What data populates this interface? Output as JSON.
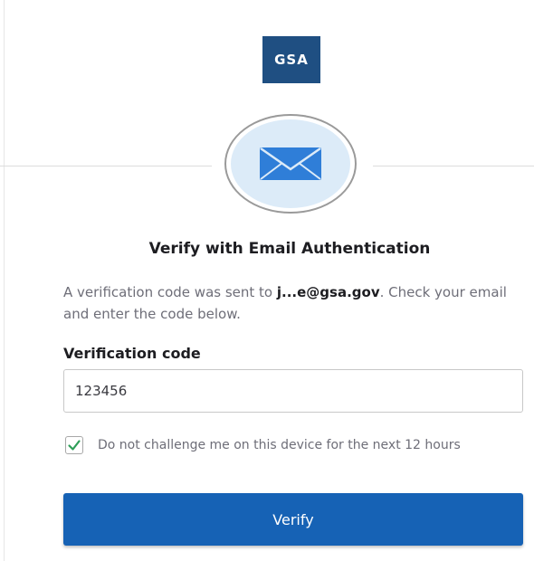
{
  "logo": {
    "text": "GSA"
  },
  "page": {
    "title": "Verify with Email Authentication",
    "description_prefix": "A verification code was sent to ",
    "masked_email": "j...e@gsa.gov",
    "description_suffix": ". Check your email and enter the code below."
  },
  "form": {
    "code_label": "Verification code",
    "code_value": "123456",
    "remember_checked": true,
    "remember_label": "Do not challenge me on this device for the next 12 hours",
    "submit_label": "Verify"
  },
  "colors": {
    "brand": "#1f4f82",
    "button": "#1662b5",
    "icon_fill": "#dcebf8",
    "icon_stroke": "#2f7ed8",
    "check": "#2e9e58"
  },
  "icons": {
    "factor": "envelope-icon",
    "checkbox": "checkmark-icon"
  }
}
